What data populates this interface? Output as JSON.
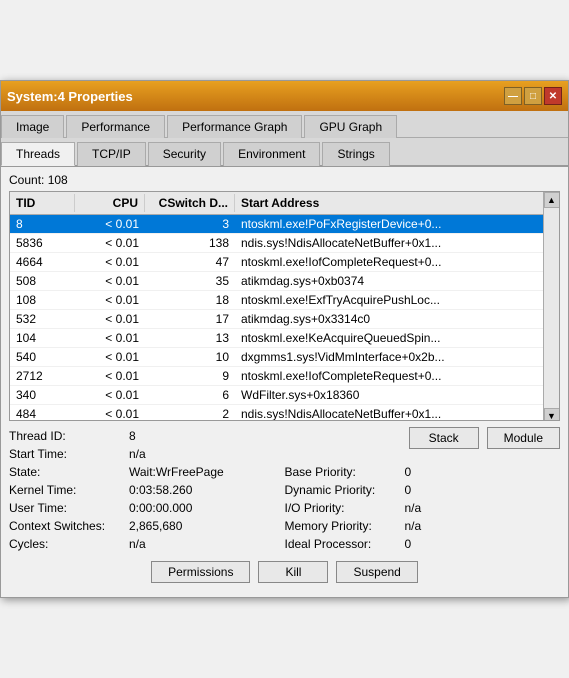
{
  "window": {
    "title": "System:4 Properties",
    "min_btn": "—",
    "max_btn": "□",
    "close_btn": "✕"
  },
  "tabs_row1": [
    {
      "label": "Image",
      "active": false
    },
    {
      "label": "Performance",
      "active": false
    },
    {
      "label": "Performance Graph",
      "active": false
    },
    {
      "label": "GPU Graph",
      "active": false
    }
  ],
  "tabs_row2": [
    {
      "label": "Threads",
      "active": true
    },
    {
      "label": "TCP/IP",
      "active": false
    },
    {
      "label": "Security",
      "active": false
    },
    {
      "label": "Environment",
      "active": false
    },
    {
      "label": "Strings",
      "active": false
    }
  ],
  "count_label": "Count:",
  "count_value": "108",
  "table": {
    "headers": [
      "TID",
      "CPU",
      "CSwitch D...",
      "Start Address"
    ],
    "rows": [
      {
        "tid": "8",
        "cpu": "< 0.01",
        "cswitch": "3",
        "address": "ntoskml.exe!PoFxRegisterDevice+0...",
        "selected": true
      },
      {
        "tid": "5836",
        "cpu": "< 0.01",
        "cswitch": "138",
        "address": "ndis.sys!NdisAllocateNetBuffer+0x1...",
        "selected": false
      },
      {
        "tid": "4664",
        "cpu": "< 0.01",
        "cswitch": "47",
        "address": "ntoskml.exe!IofCompleteRequest+0...",
        "selected": false
      },
      {
        "tid": "508",
        "cpu": "< 0.01",
        "cswitch": "35",
        "address": "atikmdag.sys+0xb0374",
        "selected": false
      },
      {
        "tid": "108",
        "cpu": "< 0.01",
        "cswitch": "18",
        "address": "ntoskml.exe!ExfTryAcquirePushLoc...",
        "selected": false
      },
      {
        "tid": "532",
        "cpu": "< 0.01",
        "cswitch": "17",
        "address": "atikmdag.sys+0x3314c0",
        "selected": false
      },
      {
        "tid": "104",
        "cpu": "< 0.01",
        "cswitch": "13",
        "address": "ntoskml.exe!KeAcquireQueuedSpin...",
        "selected": false
      },
      {
        "tid": "540",
        "cpu": "< 0.01",
        "cswitch": "10",
        "address": "dxgmms1.sys!VidMmInterface+0x2b...",
        "selected": false
      },
      {
        "tid": "2712",
        "cpu": "< 0.01",
        "cswitch": "9",
        "address": "ntoskml.exe!IofCompleteRequest+0...",
        "selected": false
      },
      {
        "tid": "340",
        "cpu": "< 0.01",
        "cswitch": "6",
        "address": "WdFilter.sys+0x18360",
        "selected": false
      },
      {
        "tid": "484",
        "cpu": "< 0.01",
        "cswitch": "2",
        "address": "ndis.sys!NdisAllocateNetBuffer+0x1...",
        "selected": false
      }
    ]
  },
  "details": {
    "thread_id_label": "Thread ID:",
    "thread_id_value": "8",
    "start_time_label": "Start Time:",
    "start_time_value": "n/a",
    "state_label": "State:",
    "state_value": "Wait:WrFreePage",
    "base_priority_label": "Base Priority:",
    "base_priority_value": "0",
    "kernel_time_label": "Kernel Time:",
    "kernel_time_value": "0:03:58.260",
    "dynamic_priority_label": "Dynamic Priority:",
    "dynamic_priority_value": "0",
    "user_time_label": "User Time:",
    "user_time_value": "0:00:00.000",
    "io_priority_label": "I/O Priority:",
    "io_priority_value": "n/a",
    "context_switches_label": "Context Switches:",
    "context_switches_value": "2,865,680",
    "memory_priority_label": "Memory Priority:",
    "memory_priority_value": "n/a",
    "cycles_label": "Cycles:",
    "cycles_value": "n/a",
    "ideal_processor_label": "Ideal Processor:",
    "ideal_processor_value": "0"
  },
  "buttons": {
    "stack": "Stack",
    "module": "Module",
    "permissions": "Permissions",
    "kill": "Kill",
    "suspend": "Suspend"
  }
}
